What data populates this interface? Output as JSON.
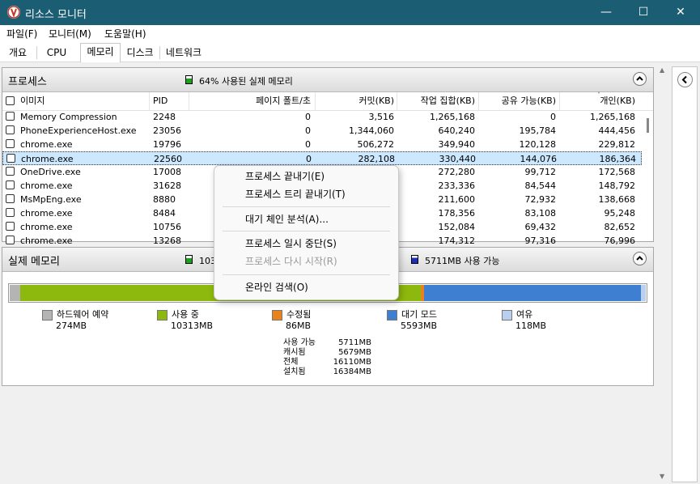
{
  "window": {
    "title": "리소스 모니터",
    "minimize": "—",
    "maximize": "☐",
    "close": "✕"
  },
  "menu": [
    "파일(F)",
    "모니터(M)",
    "도움말(H)"
  ],
  "tabs": [
    {
      "label": "개요",
      "active": false
    },
    {
      "label": "CPU",
      "active": false
    },
    {
      "label": "메모리",
      "active": true
    },
    {
      "label": "디스크",
      "active": false
    },
    {
      "label": "네트워크",
      "active": false
    }
  ],
  "process_panel": {
    "title": "프로세스",
    "status": "64% 사용된 실제 메모리",
    "columns": [
      "이미지",
      "PID",
      "페이지 폴트/초",
      "커밋(KB)",
      "작업 집합(KB)",
      "공유 가능(KB)",
      "개인(KB)"
    ],
    "rows": [
      [
        "Memory Compression",
        "2248",
        "0",
        "3,516",
        "1,265,168",
        "0",
        "1,265,168"
      ],
      [
        "PhoneExperienceHost.exe",
        "23056",
        "0",
        "1,344,060",
        "640,240",
        "195,784",
        "444,456"
      ],
      [
        "chrome.exe",
        "19796",
        "0",
        "506,272",
        "349,940",
        "120,128",
        "229,812"
      ],
      [
        "chrome.exe",
        "22560",
        "0",
        "282,108",
        "330,440",
        "144,076",
        "186,364"
      ],
      [
        "OneDrive.exe",
        "17008",
        "",
        "",
        "272,280",
        "99,712",
        "172,568"
      ],
      [
        "chrome.exe",
        "31628",
        "",
        "",
        "233,336",
        "84,544",
        "148,792"
      ],
      [
        "MsMpEng.exe",
        "8880",
        "",
        "",
        "211,600",
        "72,932",
        "138,668"
      ],
      [
        "chrome.exe",
        "8484",
        "",
        "",
        "178,356",
        "83,108",
        "95,248"
      ],
      [
        "chrome.exe",
        "10756",
        "",
        "",
        "152,084",
        "69,432",
        "82,652"
      ],
      [
        "chrome.exe",
        "13268",
        "",
        "",
        "174,312",
        "97,316",
        "76,996"
      ]
    ],
    "selected_row": 3
  },
  "memory_panel": {
    "title": "실제 메모리",
    "in_use_status": "10313MB 사용 중",
    "available_status": "5711MB 사용 가능",
    "bar": {
      "reserved": 274,
      "in_use": 10313,
      "modified": 86,
      "standby": 5593,
      "free": 118,
      "total": 16384
    },
    "legend": [
      {
        "label": "하드웨어 예약",
        "value": "274MB",
        "color": "#b4b4b4"
      },
      {
        "label": "사용 중",
        "value": "10313MB",
        "color": "#8db80d"
      },
      {
        "label": "수정됨",
        "value": "86MB",
        "color": "#e8821c"
      },
      {
        "label": "대기 모드",
        "value": "5593MB",
        "color": "#3f7fd1"
      },
      {
        "label": "여유",
        "value": "118MB",
        "color": "#b9cfee"
      }
    ],
    "stats": [
      {
        "label": "사용 가능",
        "value": "5711MB"
      },
      {
        "label": "캐시됨",
        "value": "5679MB"
      },
      {
        "label": "전체",
        "value": "16110MB"
      },
      {
        "label": "설치됨",
        "value": "16384MB"
      }
    ]
  },
  "context_menu": [
    {
      "label": "프로세스 끝내기(E)",
      "enabled": true
    },
    {
      "label": "프로세스 트리 끝내기(T)",
      "enabled": true
    },
    {
      "label": "대기 체인 분석(A)...",
      "enabled": true
    },
    {
      "label": "프로세스 일시 중단(S)",
      "enabled": true
    },
    {
      "label": "프로세스 다시 시작(R)",
      "enabled": false
    },
    {
      "label": "온라인 검색(O)",
      "enabled": true
    }
  ],
  "colors": {
    "titlebar": "#1b5d72",
    "in_use": "#8db80d",
    "standby": "#3f7fd1",
    "selection": "#cce8ff"
  }
}
